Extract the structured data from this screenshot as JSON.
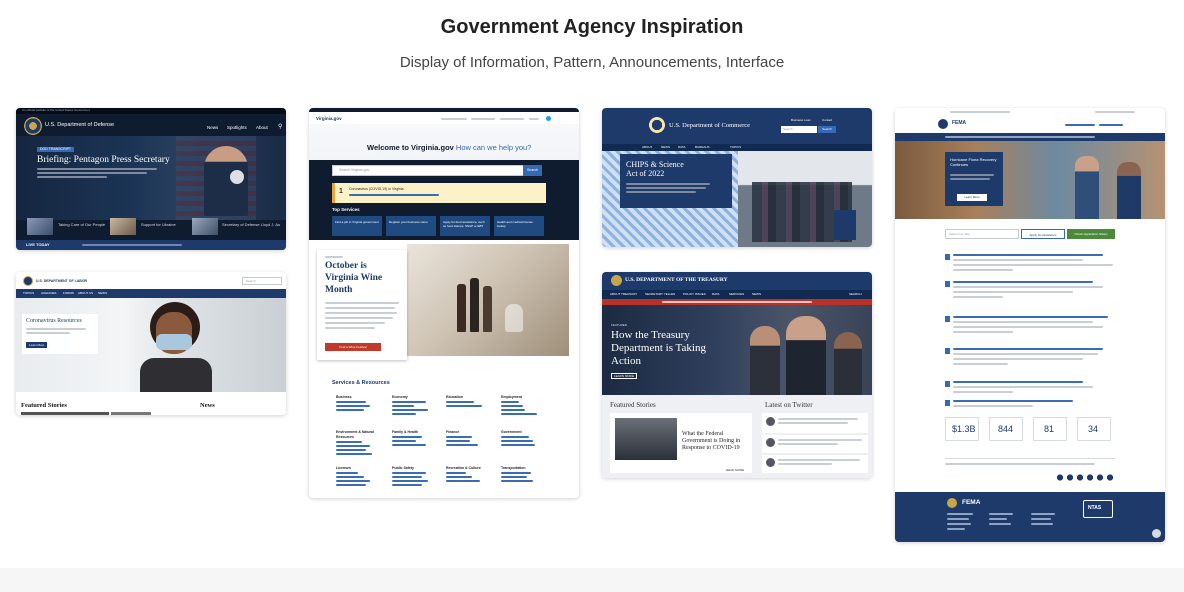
{
  "page": {
    "title": "Government Agency Inspiration",
    "subtitle": "Display of Information, Pattern, Announcements, Interface"
  },
  "cards": {
    "dod": {
      "banner": "An official website of the United States Government",
      "brand": "U.S. Department of Defense",
      "nav": [
        "News",
        "Spotlights",
        "About"
      ],
      "tag": "DOD TRANSCRIPT",
      "headline": "Briefing: Pentagon Press Secretary",
      "thumbs": [
        "Taking Care of Our People",
        "Support for Ukraine",
        "Secretary of Defense Lloyd J. Austin III"
      ],
      "live": "LIVE TODAY"
    },
    "dol": {
      "brand": "U.S. DEPARTMENT OF LABOR",
      "nav": [
        "TOPICS",
        "AGENCIES",
        "FORMS",
        "ABOUT US",
        "NEWS"
      ],
      "search_placeholder": "Search",
      "hero_title": "Coronavirus Resources",
      "hero_button": "Learn More",
      "featured": "Featured Stories",
      "news": "News"
    },
    "virginia": {
      "logo": "Virginia.gov",
      "welcome_bold": "Welcome to Virginia.gov",
      "welcome_rest": "How can we help you?",
      "search_placeholder": "Search Virginia.gov",
      "search_button": "Search",
      "alert_number": "1",
      "alert_title": "Coronavirus (COVID-19) in Virginia",
      "top_services": "Top Services",
      "services": [
        "Find a job in Virginia government",
        "Register your business name",
        "Apply for food assistance, such as food stamps, SNAP or EBT",
        "Health and medical license lookup"
      ],
      "promo_title": "October is Virginia Wine Month",
      "promo_button": "Find a Wine Festival",
      "resources_title": "Services & Resources",
      "resource_cols": [
        "Business",
        "Economy",
        "Education",
        "Employment",
        "Environment & Natural Resources",
        "Family & Health",
        "Finance",
        "Government",
        "Licenses",
        "Public Safety",
        "Recreation & Culture",
        "Transportation"
      ]
    },
    "commerce": {
      "brand": "U.S. Department of Commerce",
      "links": [
        "Business Loan",
        "Contact"
      ],
      "search_placeholder": "Search",
      "search_button": "Search",
      "nav": [
        "ABOUT",
        "NEWS",
        "DATA",
        "BUREAUS",
        "TOPICS"
      ],
      "hero_title": "CHIPS & Science Act of 2022"
    },
    "treasury": {
      "brand": "U.S. DEPARTMENT OF THE TREASURY",
      "nav": [
        "ABOUT TREASURY",
        "SECRETARY YELLEN",
        "POLICY ISSUES",
        "DATA",
        "SERVICES",
        "NEWS"
      ],
      "search": "SEARCH",
      "kicker": "FEATURED",
      "hero_title": "How the Treasury Department is Taking Action",
      "hero_button": "LEARN MORE",
      "featured": "Featured Stories",
      "twitter": "Latest on Twitter",
      "story_title": "What the Federal Government is Doing in Response to COVID-19",
      "story_button": "READ MORE"
    },
    "fema": {
      "brand": "FEMA",
      "hero_title": "Hurricane Fiona Recovery Continues",
      "hero_button": "Learn More",
      "search_placeholder": "Search our Site",
      "apply_button": "Apply for Assistance",
      "check_button": "Check Application Status",
      "stats": [
        "$1.3B",
        "844",
        "81",
        "34"
      ],
      "footer_brand": "FEMA",
      "ntas": "NTAS"
    }
  }
}
